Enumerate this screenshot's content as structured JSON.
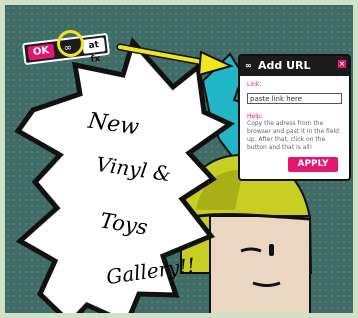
{
  "toolbar": {
    "ok_label": "OK",
    "link_icon": "link-icon",
    "fx_label": "at fx"
  },
  "panel": {
    "title": "Add URL",
    "link_label": "Link:",
    "url_value": "paste link here",
    "help_label": "Help:",
    "help_text": "Copy the adress from the browser and past it in the field up. After that, click on the button and that is all!",
    "apply_label": "APPLY"
  },
  "burst": {
    "line1": "New",
    "line2": "Vinyl &",
    "line3": "Toys",
    "line4": "Gallery!!"
  },
  "colors": {
    "accent": "#e41670",
    "highlight": "#f1e51b",
    "background": "#3f6c66"
  }
}
